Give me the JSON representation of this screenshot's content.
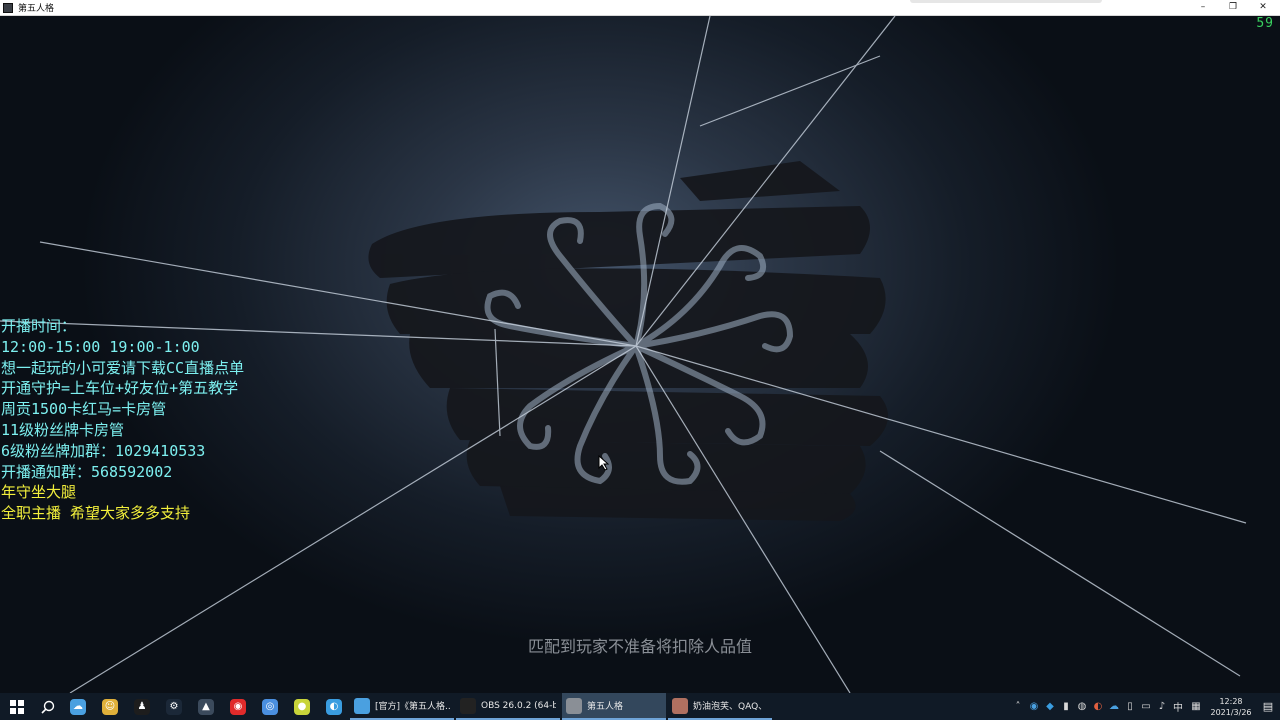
{
  "window": {
    "title": "第五人格",
    "controls": {
      "minimize": "–",
      "maximize": "❐",
      "close": "✕"
    }
  },
  "game": {
    "fps": "59",
    "stream_overlay": [
      {
        "text": "开播时间：",
        "color": "#7df0f0"
      },
      {
        "text": "12:00-15:00 19:00-1:00",
        "color": "#7df0f0"
      },
      {
        "text": "想一起玩的小可爱请下载CC直播点单",
        "color": "#7df0f0"
      },
      {
        "text": "开通守护=上车位+好友位+第五教学",
        "color": "#7df0f0"
      },
      {
        "text": "周贡1500卡红马=卡房管",
        "color": "#7df0f0"
      },
      {
        "text": "11级粉丝牌卡房管",
        "color": "#7df0f0"
      },
      {
        "text": "6级粉丝牌加群：1029410533",
        "color": "#7df0f0"
      },
      {
        "text": "开播通知群：568592002",
        "color": "#7df0f0"
      },
      {
        "text": "年守坐大腿",
        "color": "#f3f03c"
      },
      {
        "text": "全职主播 希望大家多多支持",
        "color": "#f3f03c"
      }
    ],
    "loading_hint": "匹配到玩家不准备将扣除人品值"
  },
  "taskbar": {
    "pinned": [
      {
        "name": "weather-app-icon",
        "glyph": "☁",
        "color": "#4aa0e0"
      },
      {
        "name": "game-helper-icon",
        "glyph": "☺",
        "color": "#e0b03a"
      },
      {
        "name": "qq-icon",
        "glyph": "♟",
        "color": "#1d1d1d"
      },
      {
        "name": "steam-icon",
        "glyph": "⚙",
        "color": "#1b2838"
      },
      {
        "name": "vehicle-app-icon",
        "glyph": "▲",
        "color": "#3b4a5c"
      },
      {
        "name": "netease-music-icon",
        "glyph": "◉",
        "color": "#e02b2b"
      },
      {
        "name": "chrome-icon",
        "glyph": "◎",
        "color": "#4a8fe0"
      },
      {
        "name": "green-app-icon",
        "glyph": "●",
        "color": "#c8d43a"
      },
      {
        "name": "browser-icon",
        "glyph": "◐",
        "color": "#3a9de0"
      }
    ],
    "tasks": [
      {
        "label": "[官方]《第五人格...",
        "icon_color": "#4aa0e0",
        "active": false
      },
      {
        "label": "OBS 26.0.2 (64-bi...",
        "icon_color": "#222222",
        "active": false
      },
      {
        "label": "第五人格",
        "icon_color": "#8a8f96",
        "active": true
      },
      {
        "label": "奶油泡芙、QAQ、...",
        "icon_color": "#b07060",
        "active": false
      }
    ],
    "tray": {
      "ime": "中",
      "time": "12:28",
      "date": "2021/3/26"
    }
  }
}
